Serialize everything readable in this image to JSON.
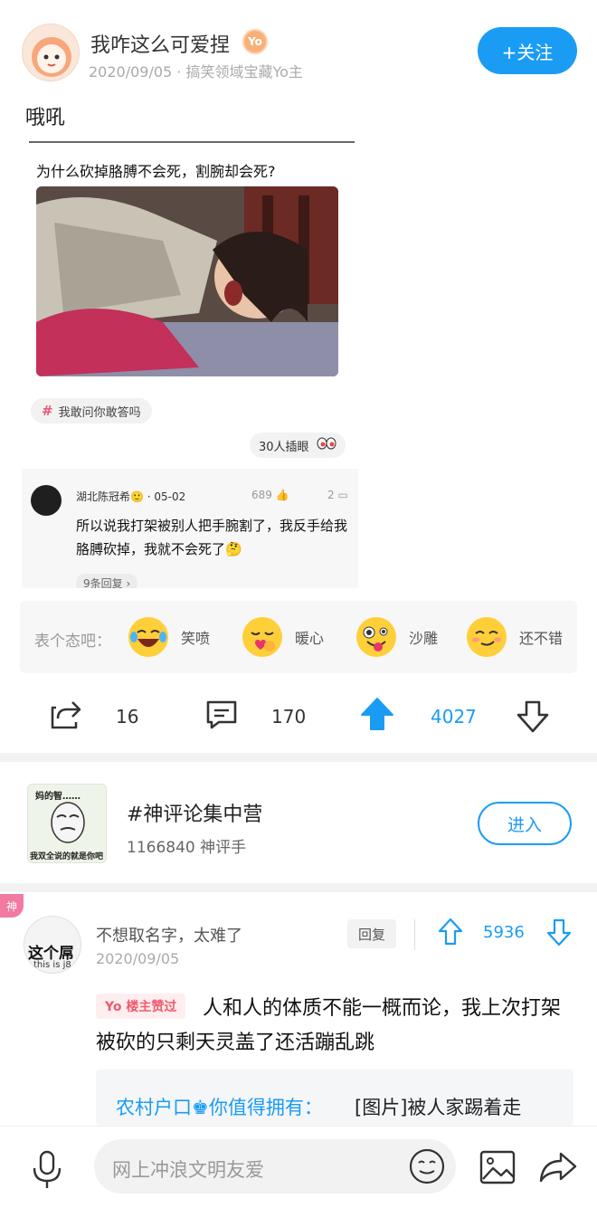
{
  "post": {
    "username": "我咋这么可爱捏",
    "user_badge": "Yo",
    "meta": "2020/09/05 · 搞笑领域宝藏Yo主",
    "follow_label": "+关注",
    "text": "哦吼"
  },
  "embed": {
    "question": "为什么砍掉胳膊不会死，割腕却会死?",
    "tag": "我敢问你敢答吗",
    "peek": "30人插眼",
    "comment": {
      "user": "湖北陈冠希🙂 · 05-02",
      "likes": "689",
      "replies": "2",
      "text": "所以说我打架被别人把手腕割了，我反手给我胳膊砍掉，我就不会死了🤔",
      "more": "9条回复 ›"
    }
  },
  "reactions": {
    "label": "表个态吧：",
    "items": [
      {
        "icon": "laughing-crying-emoji-icon",
        "label": "笑喷"
      },
      {
        "icon": "heart-hug-emoji-icon",
        "label": "暖心"
      },
      {
        "icon": "goofy-emoji-icon",
        "label": "沙雕"
      },
      {
        "icon": "satisfied-emoji-icon",
        "label": "还不错"
      }
    ]
  },
  "actions": {
    "share_count": "16",
    "comment_count": "170",
    "upvote_count": "4027"
  },
  "topic": {
    "image_text_top": "妈的智……",
    "image_text_bottom": "我双全说的就是你吧",
    "title": "#神评论集中营",
    "subtitle": "1166840 神评手",
    "enter_label": "进入"
  },
  "comment": {
    "god_badge": "神",
    "avatar_text": "这个屌",
    "avatar_subtext": "this is j8",
    "username": "不想取名字，太难了",
    "date": "2020/09/05",
    "reply_label": "回复",
    "likes": "5936",
    "owner_badge": "Yo 楼主赞过",
    "text": "人和人的体质不能一概而论，我上次打架被砍的只剩天灵盖了还活蹦乱跳",
    "sub_reply_user": "农村户口♚你值得拥有：",
    "sub_reply_text": "[图片]被人家踢着走"
  },
  "input": {
    "placeholder": "网上冲浪文明友爱"
  },
  "colors": {
    "accent": "#1a9cf4",
    "pink": "#ef5b6b"
  }
}
